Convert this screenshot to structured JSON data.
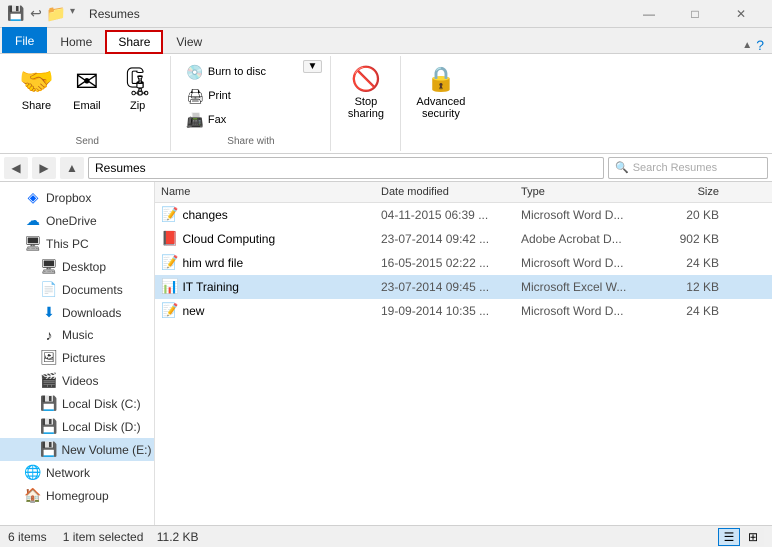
{
  "window": {
    "title": "Resumes",
    "controls": {
      "minimize": "—",
      "maximize": "□",
      "close": "✕"
    }
  },
  "tabs": {
    "file": "File",
    "home": "Home",
    "share": "Share",
    "view": "View"
  },
  "ribbon": {
    "send_group_label": "Send",
    "share_with_group_label": "Share with",
    "send_buttons": {
      "share": "Share",
      "email": "Email",
      "zip": "Zip"
    },
    "share_with_buttons": {
      "burn": "Burn to disc",
      "print": "Print",
      "fax": "Fax"
    },
    "stop_sharing": "Stop sharing",
    "advanced_security": "Advanced security"
  },
  "address": {
    "path": "Resumes",
    "search_placeholder": "Search Resumes"
  },
  "sidebar": {
    "items": [
      {
        "id": "onedrive",
        "label": "OneDrive",
        "icon": "☁",
        "indent": 1
      },
      {
        "id": "this-pc",
        "label": "This PC",
        "icon": "💻",
        "indent": 1
      },
      {
        "id": "desktop",
        "label": "Desktop",
        "icon": "🖥",
        "indent": 2
      },
      {
        "id": "documents",
        "label": "Documents",
        "icon": "📁",
        "indent": 2
      },
      {
        "id": "downloads",
        "label": "Downloads",
        "icon": "⬇",
        "indent": 2
      },
      {
        "id": "music",
        "label": "Music",
        "icon": "♪",
        "indent": 2
      },
      {
        "id": "pictures",
        "label": "Pictures",
        "icon": "🖼",
        "indent": 2
      },
      {
        "id": "videos",
        "label": "Videos",
        "icon": "🎬",
        "indent": 2
      },
      {
        "id": "local-c",
        "label": "Local Disk (C:)",
        "icon": "💾",
        "indent": 2
      },
      {
        "id": "local-d",
        "label": "Local Disk (D:)",
        "icon": "💾",
        "indent": 2
      },
      {
        "id": "new-volume",
        "label": "New Volume (E:)",
        "icon": "💾",
        "indent": 2,
        "selected": true
      },
      {
        "id": "network",
        "label": "Network",
        "icon": "🌐",
        "indent": 1
      },
      {
        "id": "homegroup",
        "label": "Homegroup",
        "icon": "🏠",
        "indent": 1
      }
    ]
  },
  "file_list": {
    "columns": {
      "name": "Name",
      "date": "Date modified",
      "type": "Type",
      "size": "Size"
    },
    "files": [
      {
        "name": "changes",
        "icon": "word",
        "date": "04-11-2015 06:39 ...",
        "type": "Microsoft Word D...",
        "size": "20 KB"
      },
      {
        "name": "Cloud Computing",
        "icon": "pdf",
        "date": "23-07-2014 09:42 ...",
        "type": "Adobe Acrobat D...",
        "size": "902 KB"
      },
      {
        "name": "him wrd file",
        "icon": "word",
        "date": "16-05-2015 02:22 ...",
        "type": "Microsoft Word D...",
        "size": "24 KB"
      },
      {
        "name": "IT Training",
        "icon": "excel",
        "date": "23-07-2014 09:45 ...",
        "type": "Microsoft Excel W...",
        "size": "12 KB",
        "selected": true
      },
      {
        "name": "new",
        "icon": "word",
        "date": "19-09-2014 10:35 ...",
        "type": "Microsoft Word D...",
        "size": "24 KB"
      }
    ]
  },
  "status": {
    "count": "6 items",
    "selection": "1 item selected",
    "size": "11.2 KB"
  }
}
